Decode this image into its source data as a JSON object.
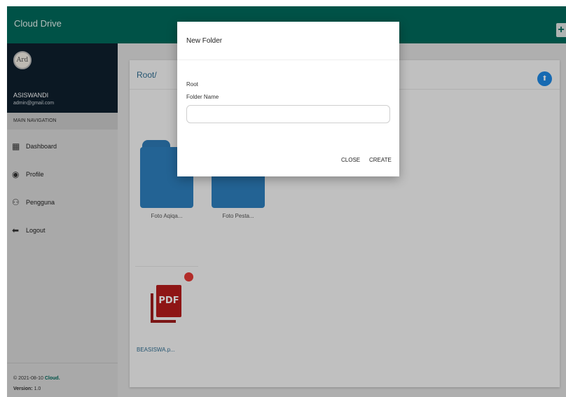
{
  "app": {
    "brand": "Cloud Drive",
    "add_icon": "plus-icon",
    "add_label": "+"
  },
  "user": {
    "avatar_text": "Ard",
    "name": "ASISWANDI",
    "email": "admin@gmail.com"
  },
  "sidebar": {
    "section_header": "MAIN NAVIGATION",
    "items": [
      {
        "label": "Dashboard",
        "icon": "dashboard-icon",
        "glyph": "▦"
      },
      {
        "label": "Profile",
        "icon": "user-circle-icon",
        "glyph": "◉"
      },
      {
        "label": "Pengguna",
        "icon": "users-icon",
        "glyph": "⚇"
      },
      {
        "label": "Logout",
        "icon": "reply-arrow-icon",
        "glyph": "⬅"
      }
    ],
    "footer": {
      "copyright": "© 2021-08-10",
      "brand": "Cloud.",
      "version_label": "Version:",
      "version_value": "1.0"
    }
  },
  "main": {
    "breadcrumb": "Root/",
    "upload_icon": "upload-icon",
    "upload_glyph": "⬆",
    "folders": [
      {
        "name": "Foto Aqiqa..."
      },
      {
        "name": "Foto Pesta..."
      }
    ],
    "files": [
      {
        "name": "BEASISWA.p...",
        "type_label": "PDF",
        "icon": "pdf-file-icon"
      }
    ]
  },
  "modal": {
    "title": "New Folder",
    "parent": "Root",
    "field_label": "Folder Name",
    "field_value": "",
    "field_placeholder": "",
    "close_label": "CLOSE",
    "create_label": "CREATE"
  },
  "colors": {
    "topbar": "#00695c",
    "user_panel": "#0f1f2d",
    "folder": "#2e7fbe",
    "pdf": "#b71c1c",
    "badge": "#e53935",
    "upload_button": "#1e88e5"
  }
}
